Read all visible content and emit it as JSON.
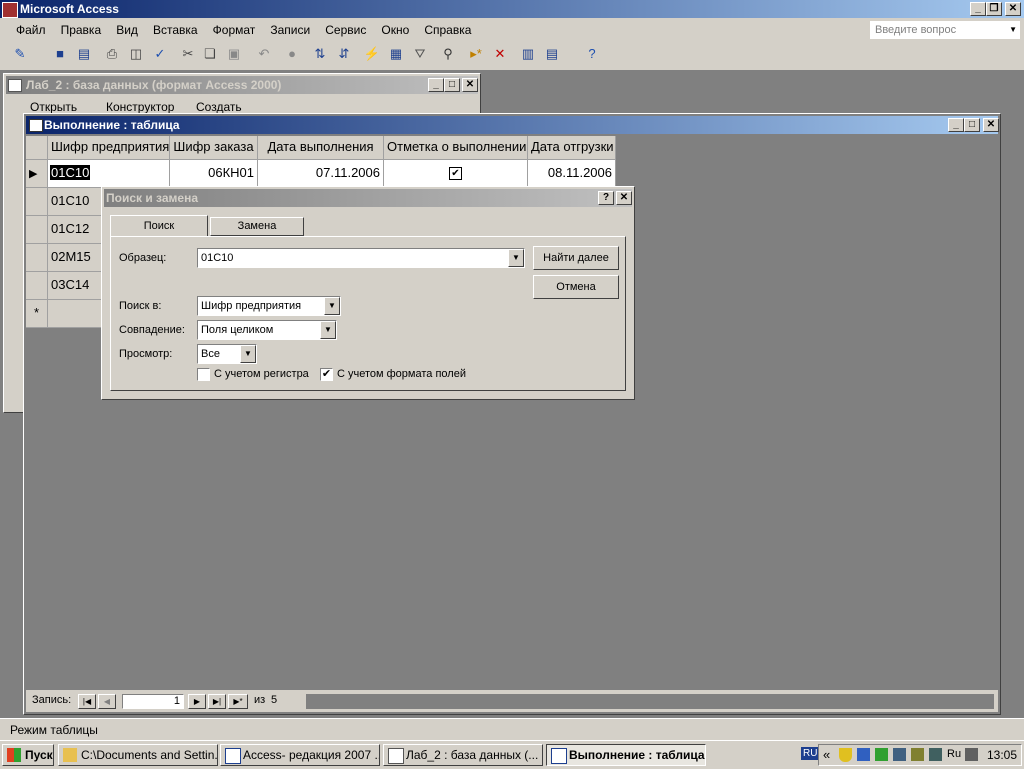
{
  "app": {
    "title": "Microsoft Access",
    "ask_placeholder": "Введите вопрос"
  },
  "menu": [
    "Файл",
    "Правка",
    "Вид",
    "Вставка",
    "Формат",
    "Записи",
    "Сервис",
    "Окно",
    "Справка"
  ],
  "db_window": {
    "title": "Лаб_2 : база данных (формат Access 2000)",
    "toolbar": [
      "Открыть",
      "Конструктор",
      "Создать"
    ]
  },
  "table_window": {
    "title": "Выполнение : таблица"
  },
  "table": {
    "columns": [
      "Шифр предприятия",
      "Шифр заказа",
      "Дата выполнения",
      "Отметка о выполнении",
      "Дата отгрузки"
    ],
    "rows": [
      {
        "code": "01С10",
        "order": "06КН01",
        "date": "07.11.2006",
        "done": true,
        "ship": "08.11.2006"
      },
      {
        "code": "01С10"
      },
      {
        "code": "01С12"
      },
      {
        "code": "02М15"
      },
      {
        "code": "03С14"
      }
    ],
    "new_row_marker": "*"
  },
  "navigator": {
    "label": "Запись:",
    "current": "1",
    "of_label": "из",
    "total": "5"
  },
  "dialog": {
    "title": "Поиск и замена",
    "tabs": [
      "Поиск",
      "Замена"
    ],
    "pattern_label": "Образец:",
    "pattern_value": "01С10",
    "find_next": "Найти далее",
    "cancel": "Отмена",
    "lookin_label": "Поиск в:",
    "lookin_value": "Шифр предприятия",
    "match_label": "Совпадение:",
    "match_value": "Поля целиком",
    "search_label": "Просмотр:",
    "search_value": "Все",
    "match_case_label": "С учетом регистра",
    "match_case": false,
    "format_label": "С учетом формата полей",
    "format": true
  },
  "status": {
    "mode": "Режим таблицы"
  },
  "taskbar": {
    "start": "Пуск",
    "items": [
      "C:\\Documents and Settin...",
      "Access- редакция 2007 ...",
      "Лаб_2 : база данных (...",
      "Выполнение : таблица"
    ],
    "lang": "RU",
    "lang2": "Ru",
    "clock": "13:05"
  },
  "colors": {
    "titlebar": "#0a246a",
    "face": "#d4d0c8",
    "desktop": "#808080",
    "taskbar": "#d4d0c8"
  }
}
